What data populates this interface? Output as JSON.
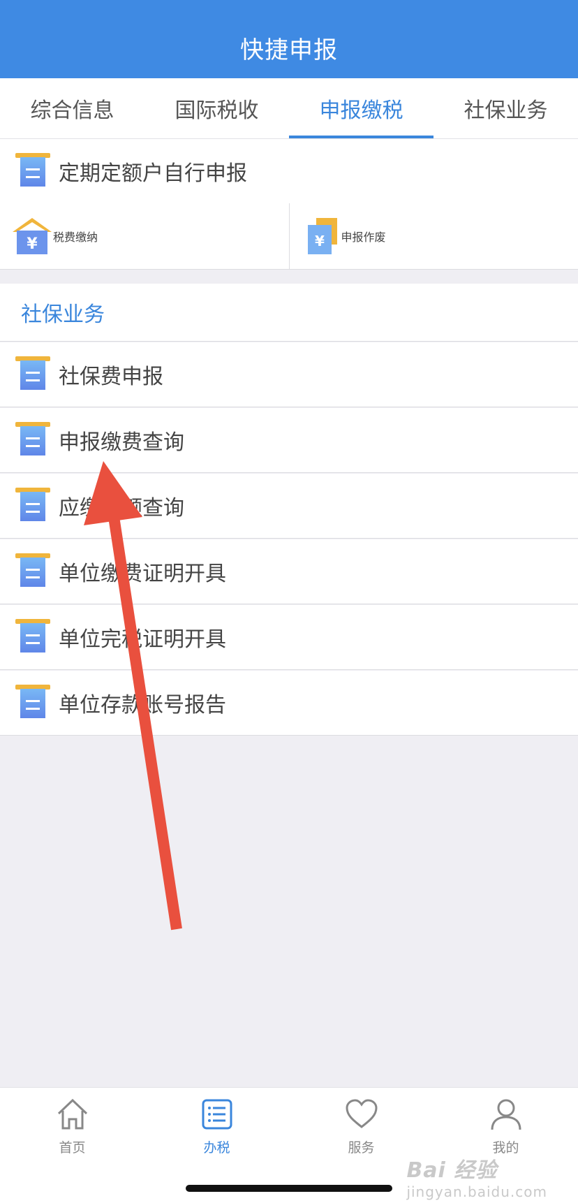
{
  "header": {
    "title": "快捷申报"
  },
  "tabs": [
    {
      "label": "综合信息"
    },
    {
      "label": "国际税收"
    },
    {
      "label": "申报缴税"
    },
    {
      "label": "社保业务"
    }
  ],
  "tax_section": {
    "periodic": "定期定额户自行申报",
    "pay": "税费缴纳",
    "void": "申报作废"
  },
  "social_section": {
    "title": "社保业务",
    "items": [
      {
        "label": "社保费申报"
      },
      {
        "label": "申报缴费查询"
      },
      {
        "label": "应缴费额查询"
      },
      {
        "label": "单位缴费证明开具"
      },
      {
        "label": "单位完税证明开具"
      },
      {
        "label": "单位存款账号报告"
      }
    ]
  },
  "tabbar": [
    {
      "label": "首页",
      "icon": "home-icon"
    },
    {
      "label": "办税",
      "icon": "list-icon"
    },
    {
      "label": "服务",
      "icon": "heart-icon"
    },
    {
      "label": "我的",
      "icon": "user-icon"
    }
  ],
  "watermark": {
    "main": "Bai 经验",
    "sub": "jingyan.baidu.com"
  },
  "colors": {
    "brand": "#3f8ae3",
    "active": "#3a86dc",
    "arrow": "#e9503e"
  }
}
